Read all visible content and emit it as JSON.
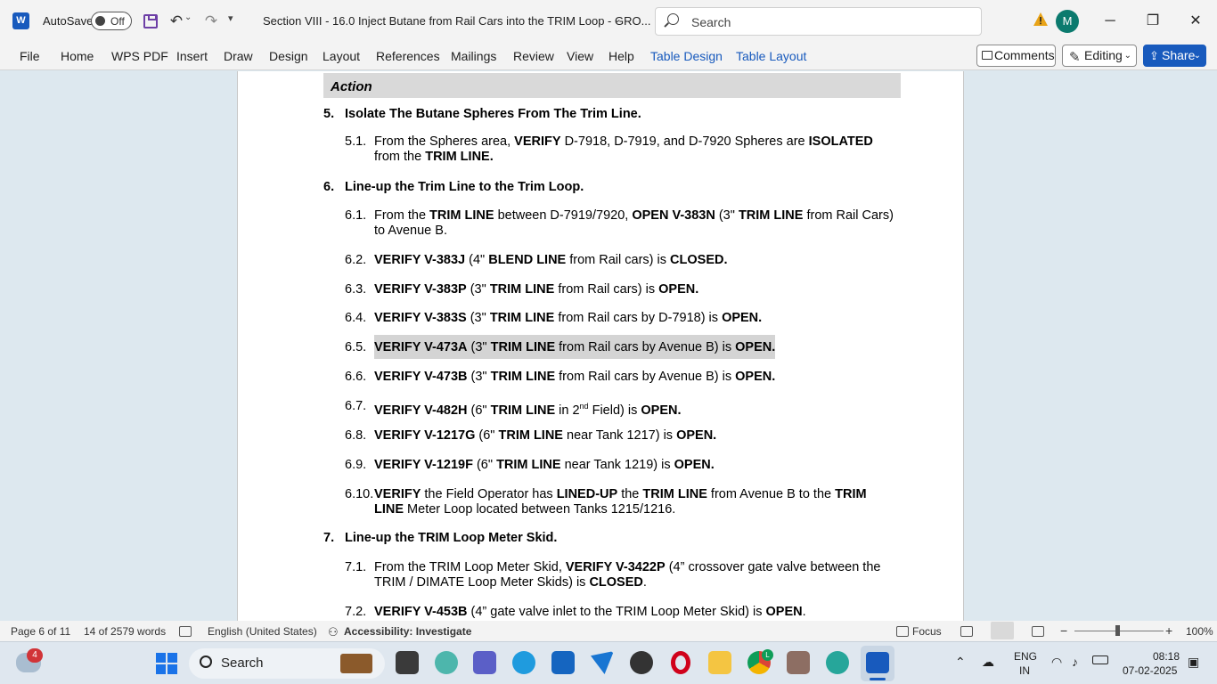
{
  "titlebar": {
    "autosave_label": "AutoSave",
    "autosave_state": "Off",
    "doc_title": "Section VIII - 16.0 Inject Butane from Rail Cars into the TRIM Loop - GRO...",
    "search_placeholder": "Search",
    "avatar_initial": "M"
  },
  "ribbon": {
    "tabs": [
      "File",
      "Home",
      "WPS PDF",
      "Insert",
      "Draw",
      "Design",
      "Layout",
      "References",
      "Mailings",
      "Review",
      "View",
      "Help",
      "Table Design",
      "Table Layout"
    ],
    "comments_label": "Comments",
    "editing_label": "Editing",
    "share_label": "Share"
  },
  "document": {
    "action_header": "Action",
    "sections": [
      {
        "num": "5.",
        "title": "Isolate The Butane Spheres From The Trim Line."
      },
      {
        "num": "6.",
        "title": "Line-up the Trim Line to the Trim Loop."
      },
      {
        "num": "7.",
        "title": "Line-up the TRIM Loop Meter Skid."
      }
    ],
    "steps": {
      "s5_1": {
        "num": "5.1."
      },
      "s6_1": {
        "num": "6.1."
      },
      "s6_2": {
        "num": "6.2."
      },
      "s6_3": {
        "num": "6.3."
      },
      "s6_4": {
        "num": "6.4."
      },
      "s6_5": {
        "num": "6.5."
      },
      "s6_6": {
        "num": "6.6."
      },
      "s6_7": {
        "num": "6.7."
      },
      "s6_8": {
        "num": "6.8."
      },
      "s6_9": {
        "num": "6.9."
      },
      "s6_10": {
        "num": "6.10."
      },
      "s7_1": {
        "num": "7.1."
      },
      "s7_2": {
        "num": "7.2."
      }
    },
    "runs": {
      "r5_1": [
        "From the Spheres area, ",
        "VERIFY",
        " D-7918, D-7919, and D-7920 Spheres are ",
        "ISOLATED",
        " from the ",
        "TRIM LINE."
      ],
      "r6_1": [
        "From the ",
        "TRIM LINE",
        " between D-7919/7920, ",
        "OPEN V-383N",
        " (3\" ",
        "TRIM LINE",
        " from Rail Cars) to Avenue B."
      ],
      "r6_2": [
        "VERIFY V-383J",
        " (4\" ",
        "BLEND LINE",
        " from Rail cars) is ",
        "CLOSED."
      ],
      "r6_3": [
        "VERIFY V-383P",
        " (3\" ",
        "TRIM LINE",
        " from Rail cars) is ",
        "OPEN."
      ],
      "r6_4": [
        "VERIFY V-383S",
        " (3\" ",
        "TRIM LINE",
        " from Rail cars by D-7918) is ",
        "OPEN."
      ],
      "r6_5": [
        "VERIFY V-473A",
        " (3\" ",
        "TRIM LINE",
        " from Rail cars by Avenue B) is ",
        "OPEN."
      ],
      "r6_6": [
        "VERIFY V-473B",
        " (3\" ",
        "TRIM LINE",
        " from Rail cars by Avenue B) is ",
        "OPEN."
      ],
      "r6_7": [
        "VERIFY V-482H",
        " (6\" ",
        "TRIM LINE",
        " in 2",
        "nd",
        " Field) is ",
        "OPEN."
      ],
      "r6_8": [
        "VERIFY V-1217G",
        " (6\" ",
        "TRIM LINE",
        " near Tank 1217) is ",
        "OPEN."
      ],
      "r6_9": [
        "VERIFY V-1219F",
        " (6\" ",
        "TRIM LINE",
        " near Tank 1219) is ",
        "OPEN."
      ],
      "r6_10": [
        "VERIFY",
        " the Field Operator has ",
        "LINED-UP",
        " the ",
        "TRIM LINE",
        " from Avenue B to the ",
        "TRIM LINE",
        " Meter Loop located between Tanks 1215/1216."
      ],
      "r7_1": [
        "From the TRIM Loop Meter Skid, ",
        "VERIFY V-3422P",
        " (4” crossover gate valve between the TRIM / DIMATE Loop Meter Skids) is ",
        "CLOSED",
        "."
      ],
      "r7_2": [
        "VERIFY V-453B",
        " (4” gate valve inlet to the TRIM Loop Meter Skid) is ",
        "OPEN",
        "."
      ]
    }
  },
  "statusbar": {
    "page": "Page 6 of 11",
    "words": "14 of 2579 words",
    "language": "English (United States)",
    "accessibility": "Accessibility: Investigate",
    "focus": "Focus",
    "zoom": "100%"
  },
  "taskbar": {
    "search_label": "Search",
    "weather_badge": "4",
    "chrome_badge": "L",
    "lang_top": "ENG",
    "lang_bottom": "IN",
    "time": "08:18",
    "date": "07-02-2025"
  },
  "colors": {
    "accent": "#185abd",
    "highlight": "#d4d4d4",
    "action_header_bg": "#d9d9d9",
    "avatar": "#0b7a6e"
  }
}
